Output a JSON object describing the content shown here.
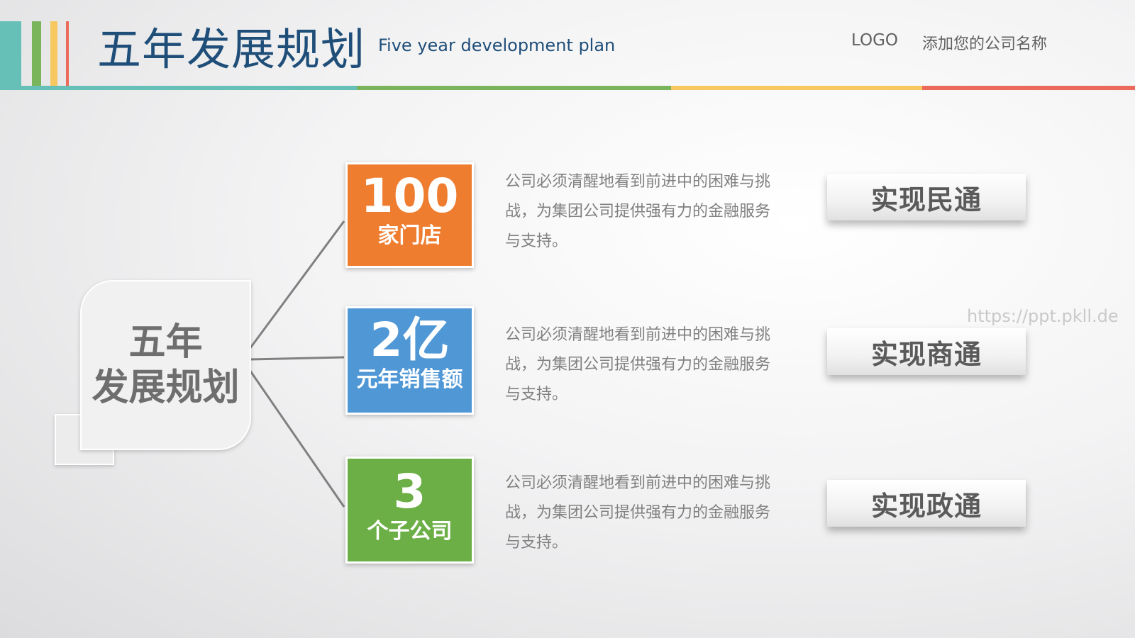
{
  "header": {
    "title": "五年发展规划",
    "subtitle": "Five year development plan",
    "logo": "LOGO",
    "company": "添加您的公司名称"
  },
  "colors": {
    "teal": "#66c0b8",
    "green": "#7ab55c",
    "yellow": "#f6c85f",
    "red": "#ec6a5c",
    "title_blue": "#1f4e79",
    "orange": "#ee7d2f",
    "blue": "#4f97d5",
    "stat_green": "#6caf46"
  },
  "center": {
    "line1": "五年",
    "line2": "发展规划"
  },
  "items": [
    {
      "value": "100",
      "label": "家门店",
      "description": "公司必须清醒地看到前进中的困难与挑战，为集团公司提供强有力的金融服务与支持。",
      "tag": "实现民通"
    },
    {
      "value": "2亿",
      "label": "元年销售额",
      "description": "公司必须清醒地看到前进中的困难与挑战，为集团公司提供强有力的金融服务与支持。",
      "tag": "实现商通"
    },
    {
      "value": "3",
      "label": "个子公司",
      "description": "公司必须清醒地看到前进中的困难与挑战，为集团公司提供强有力的金融服务与支持。",
      "tag": "实现政通"
    }
  ],
  "watermark": "https://ppt.pkll.de"
}
